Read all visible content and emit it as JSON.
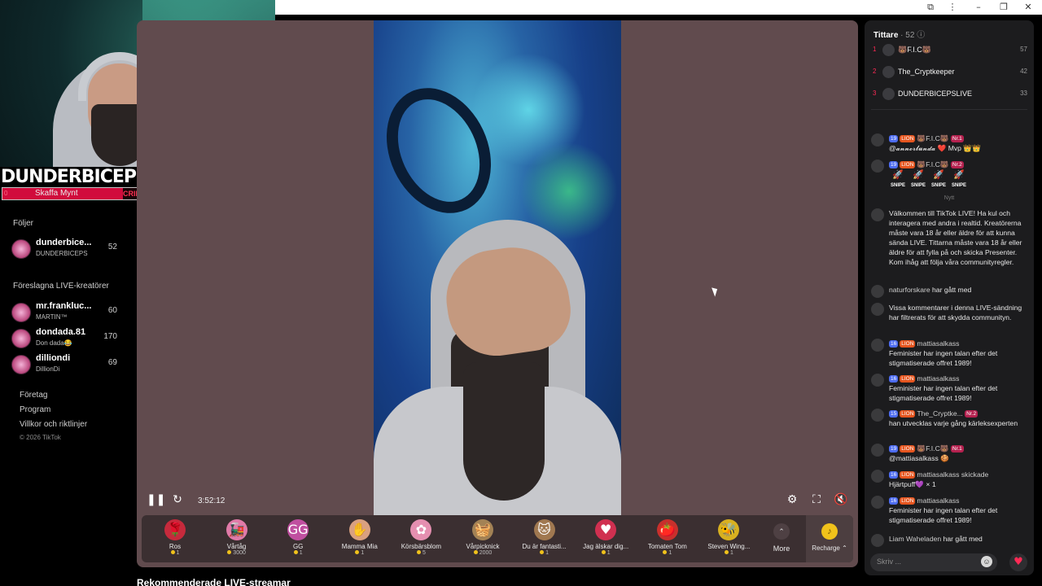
{
  "colors": {
    "accent": "#ff2a55",
    "player_bg": "#614b4e",
    "coin": "#f0c21b"
  },
  "overlay": {
    "channel_name": "DUNDERBICEPS",
    "social_letters": [
      "K",
      "♪",
      "▶"
    ],
    "goal_label": "Skaffa Mynt",
    "goal_sub": "CRIBERSGOAL",
    "goal_count_left": "0",
    "goal_count_right": "0"
  },
  "sidebar": {
    "following_heading": "Följer",
    "following": [
      {
        "name": "dunderbice...",
        "sub": "DUNDERBICEPS",
        "count": "52"
      }
    ],
    "suggested_heading": "Föreslagna LIVE-kreatörer",
    "suggested": [
      {
        "name": "mr.frankluc...",
        "sub": "MARTIN™",
        "count": "60"
      },
      {
        "name": "dondada.81",
        "sub": "Don dada😂",
        "count": "170"
      },
      {
        "name": "dilliondi",
        "sub": "DillionDi",
        "count": "69"
      }
    ],
    "links": [
      "Företag",
      "Program",
      "Villkor och riktlinjer"
    ],
    "copyright": "© 2026 TikTok"
  },
  "player": {
    "time": "3:52:12",
    "gifts": [
      {
        "name": "Ros",
        "price": "1",
        "icon": "🌹",
        "color": "#c62a3c"
      },
      {
        "name": "Vårtåg",
        "price": "3000",
        "icon": "🚂",
        "color": "#e07aa8"
      },
      {
        "name": "GG",
        "price": "1",
        "icon": "GG",
        "color": "#c04fa0"
      },
      {
        "name": "Mamma Mia",
        "price": "1",
        "icon": "✋",
        "color": "#d9a080"
      },
      {
        "name": "Körsbärsblom",
        "price": "5",
        "icon": "✿",
        "color": "#e58fb0"
      },
      {
        "name": "Vårpicknick",
        "price": "2000",
        "icon": "🧺",
        "color": "#a38255"
      },
      {
        "name": "Du är fantasti...",
        "price": "1",
        "icon": "🐱",
        "color": "#a07850"
      },
      {
        "name": "Jag älskar dig...",
        "price": "1",
        "icon": "♥",
        "color": "#d03050"
      },
      {
        "name": "Tomaten Tom",
        "price": "1",
        "icon": "🍅",
        "color": "#c8302c"
      },
      {
        "name": "Steven Wing...",
        "price": "1",
        "icon": "🐝",
        "color": "#d8b020"
      }
    ],
    "more_label": "More",
    "recharge_label": "Recharge ⌃"
  },
  "recommended_heading": "Rekommenderade LIVE-streamar",
  "chat": {
    "viewers_label": "Tittare",
    "viewers_count": "· 52",
    "top_viewers": [
      {
        "rank": "1",
        "name": "🐻F.I.C🐻",
        "score": "57"
      },
      {
        "rank": "2",
        "name": "The_Cryptkeeper",
        "score": "42"
      },
      {
        "rank": "3",
        "name": "DUNDERBICEPSLIVE",
        "score": "33"
      }
    ],
    "new_label": "Nytt",
    "messages": [
      {
        "level": "19",
        "lion": "LION",
        "user": "🐻F.I.C🐻",
        "nr": "Nr.1",
        "text": "@𝓪𝓷𝓷𝓸𝓻𝓵𝓾𝓷𝓭𝓪 ❤️ Mvp 👑👑"
      },
      {
        "level": "19",
        "lion": "LION",
        "user": "🐻F.I.C🐻",
        "nr": "Nr.2",
        "snipe": "SNIPE"
      },
      {
        "system": "Välkommen till TikTok LIVE! Ha kul och interagera med andra i realtid. Kreatörerna måste vara 18 år eller äldre för att kunna sända LIVE. Tittarna måste vara 18 år eller äldre för att fylla på och skicka Presenter. Kom ihåg att följa våra communityregler."
      },
      {
        "join_user": "naturforskare",
        "join_text": "har gått med"
      },
      {
        "system": "Vissa kommentarer i denna LIVE-sändning har filtrerats för att skydda communityn."
      },
      {
        "level": "16",
        "lion": "LION",
        "user": "mattiasalkass",
        "text": "Feminister har ingen talan efter det stigmatiserade offret 1989!"
      },
      {
        "level": "16",
        "lion": "LION",
        "user": "mattiasalkass",
        "text": "Feminister har ingen talan efter det stigmatiserade offret 1989!"
      },
      {
        "level": "15",
        "lion": "LION",
        "user": "The_Cryptke...",
        "nr": "Nr.2",
        "text": "han utvecklas varje gång kärleksexperten"
      },
      {
        "level": "19",
        "lion": "LION",
        "user": "🐻F.I.C🐻",
        "nr": "Nr.1",
        "text": "@mattiasalkass 🍪"
      },
      {
        "level": "16",
        "lion": "LION",
        "user": "mattiasalkass skickade",
        "text": "Hjärtpuff💜 × 1"
      },
      {
        "level": "16",
        "lion": "LION",
        "user": "mattiasalkass",
        "text": "Feminister har ingen talan efter det stigmatiserade offret 1989!"
      },
      {
        "join_user": "Liam Waheladen",
        "join_text": "har gått med"
      }
    ],
    "input_placeholder": "Skriv ..."
  }
}
